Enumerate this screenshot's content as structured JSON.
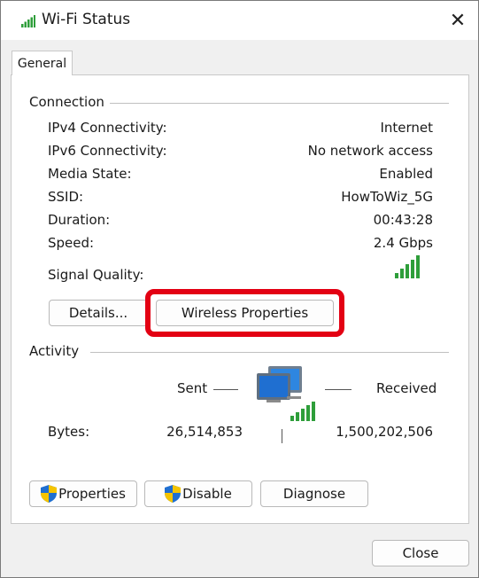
{
  "window": {
    "title": "Wi-Fi Status",
    "close_glyph": "✕"
  },
  "tabs": [
    {
      "label": "General"
    }
  ],
  "connection": {
    "section_title": "Connection",
    "rows": [
      {
        "label": "IPv4 Connectivity:",
        "value": "Internet"
      },
      {
        "label": "IPv6 Connectivity:",
        "value": "No network access"
      },
      {
        "label": "Media State:",
        "value": "Enabled"
      },
      {
        "label": "SSID:",
        "value": "HowToWiz_5G"
      },
      {
        "label": "Duration:",
        "value": "00:43:28"
      },
      {
        "label": "Speed:",
        "value": "2.4 Gbps"
      }
    ],
    "signal_label": "Signal Quality:",
    "signal_bars": 5,
    "details_button": "Details...",
    "wireless_properties_button": "Wireless Properties",
    "highlight_color": "#e30013"
  },
  "activity": {
    "section_title": "Activity",
    "sent_label": "Sent",
    "received_label": "Received",
    "bytes_label": "Bytes:",
    "bytes_sent": "26,514,853",
    "bytes_received": "1,500,202,506",
    "network_icon": "network-computers-icon"
  },
  "buttons": {
    "properties": "Properties",
    "disable": "Disable",
    "diagnose": "Diagnose",
    "close": "Close"
  },
  "colors": {
    "signal_green": "#2e9e3a",
    "shield_blue": "#1f6fd1",
    "shield_yellow": "#f5c400"
  }
}
